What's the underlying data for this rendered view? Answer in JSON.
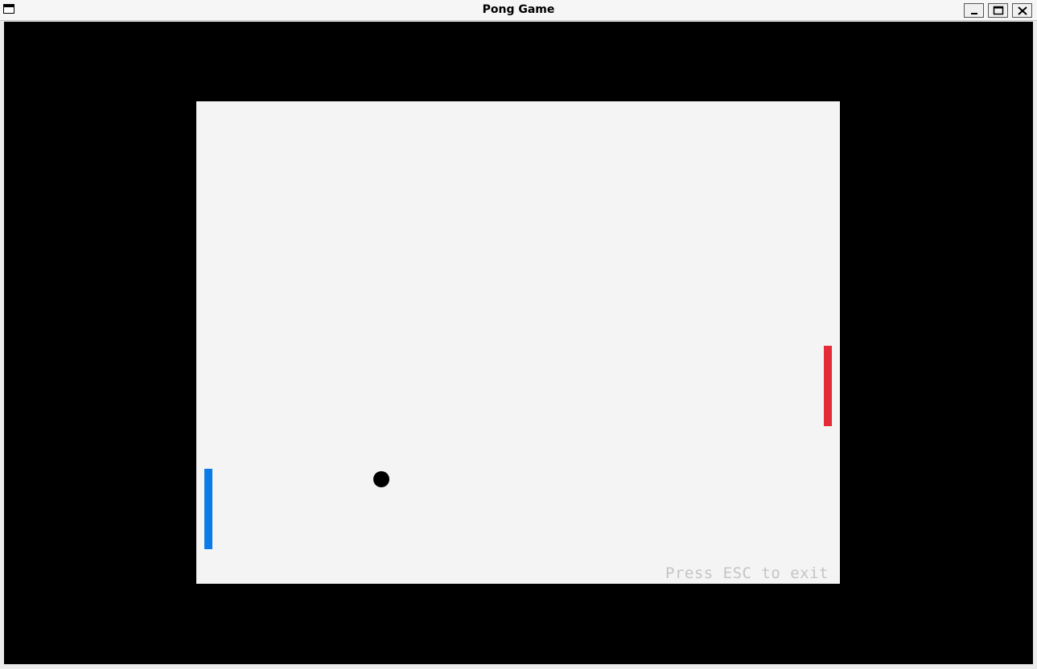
{
  "window": {
    "title": "Pong Game"
  },
  "icons": {
    "app": "window-icon",
    "minimize": "minimize-icon",
    "maximize": "maximize-icon",
    "close": "close-icon"
  },
  "game": {
    "hint": "Press ESC to exit",
    "colors": {
      "background": "#000000",
      "court": "#f4f4f4",
      "left_paddle": "#0a7be8",
      "right_paddle": "#e42b38",
      "ball": "#000000",
      "hint_text": "#c4c4c4"
    }
  }
}
